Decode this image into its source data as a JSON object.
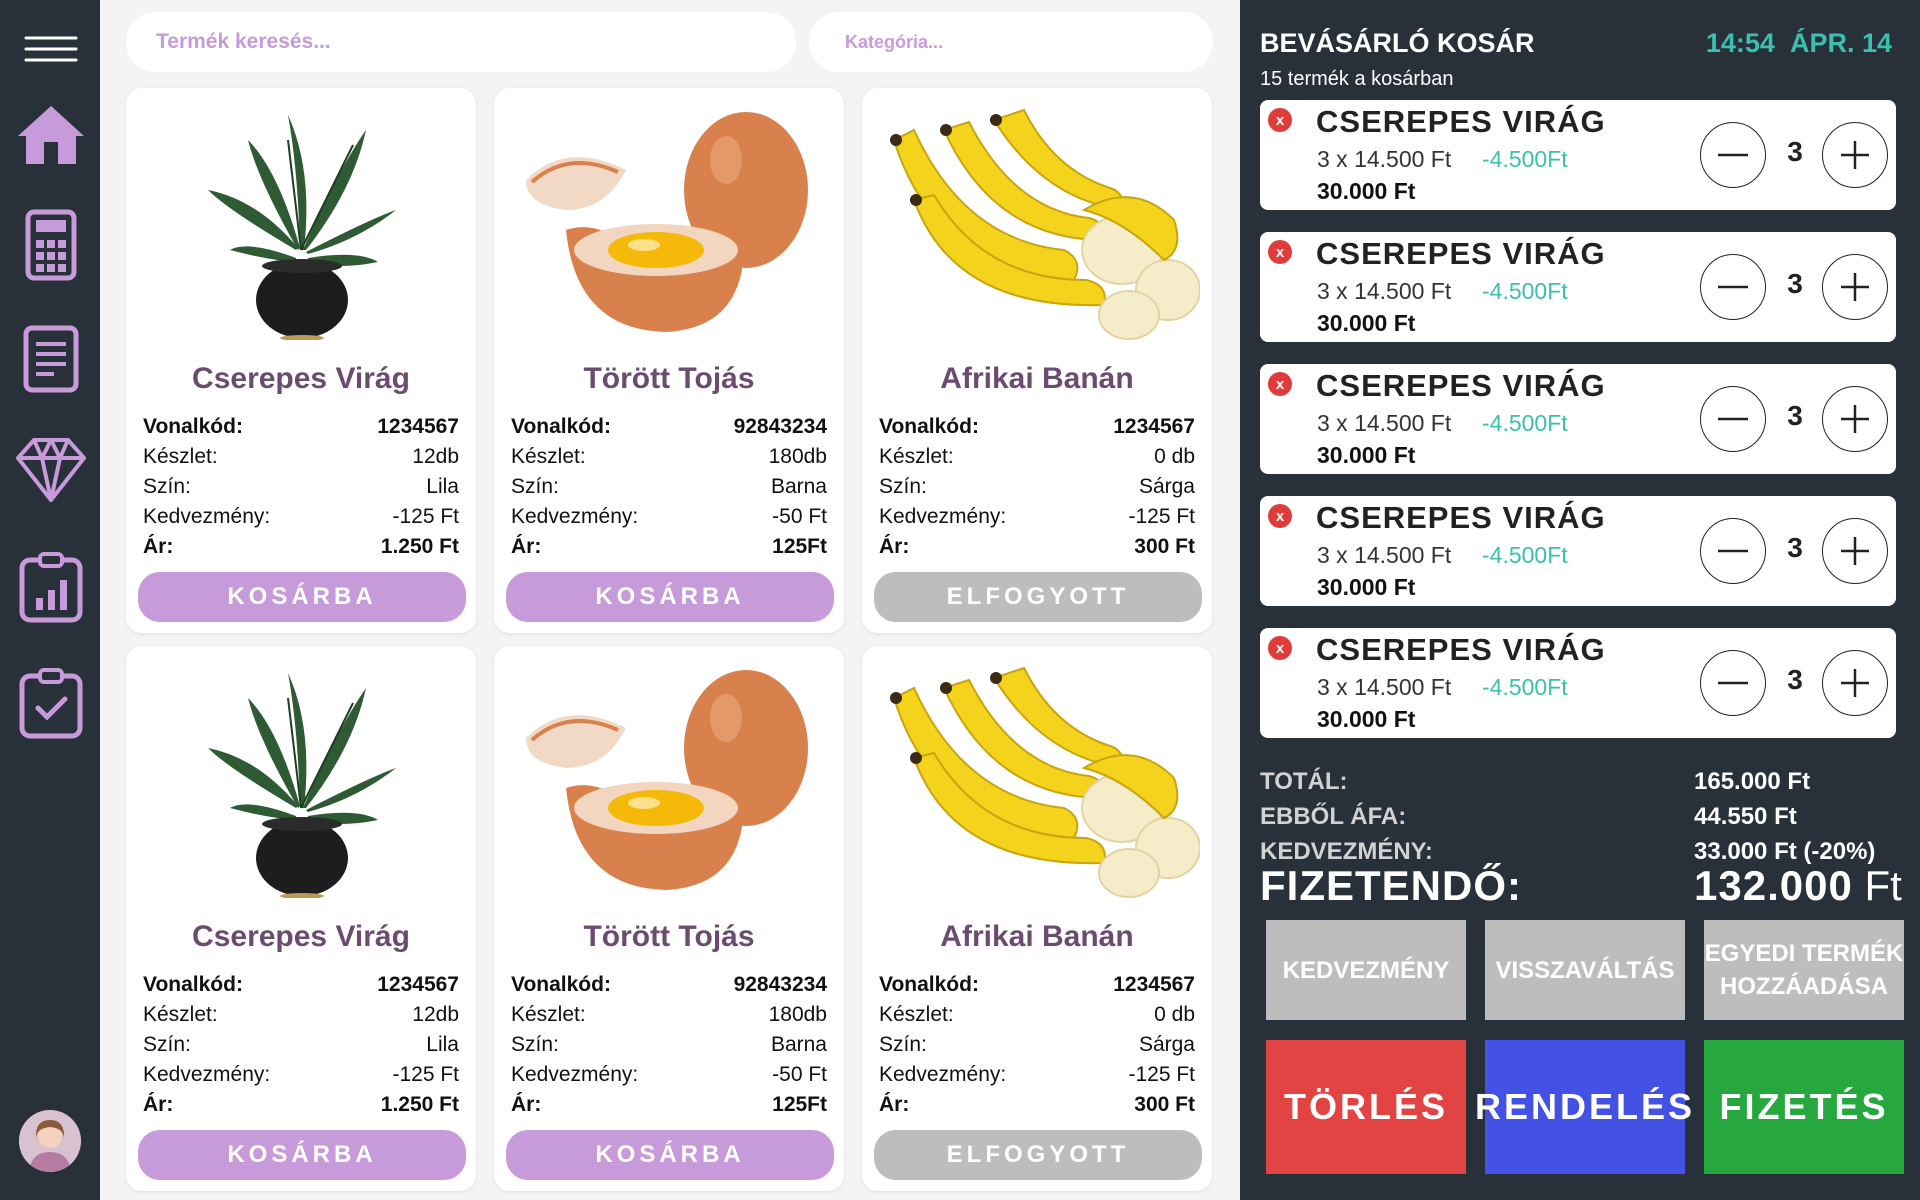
{
  "sidebar": {
    "icons": [
      "menu-icon",
      "home-icon",
      "calculator-icon",
      "document-icon",
      "diamond-icon",
      "report-icon",
      "clipboard-check-icon"
    ],
    "accent": "#c79ad9"
  },
  "search": {
    "placeholder": "Termék keresés..."
  },
  "category": {
    "placeholder": "Kategória..."
  },
  "labels": {
    "barcode": "Vonalkód:",
    "stock": "Készlet:",
    "color": "Szín:",
    "discount": "Kedvezmény:",
    "price": "Ár:"
  },
  "products": [
    {
      "title": "Cserepes Virág",
      "barcode": "1234567",
      "stock": "12db",
      "color": "Lila",
      "discount": "-125 Ft",
      "price": "1.250 Ft",
      "button": "KOSÁRBA",
      "image": "plant"
    },
    {
      "title": "Törött Tojás",
      "barcode": "92843234",
      "stock": "180db",
      "color": "Barna",
      "discount": "-50 Ft",
      "price": "125Ft",
      "button": "KOSÁRBA",
      "image": "egg"
    },
    {
      "title": "Afrikai Banán",
      "barcode": "1234567",
      "stock": "0 db",
      "color": "Sárga",
      "discount": "-125 Ft",
      "price": "300 Ft",
      "button": "ELFOGYOTT",
      "image": "banana"
    },
    {
      "title": "Cserepes Virág",
      "barcode": "1234567",
      "stock": "12db",
      "color": "Lila",
      "discount": "-125 Ft",
      "price": "1.250 Ft",
      "button": "KOSÁRBA",
      "image": "plant"
    },
    {
      "title": "Törött Tojás",
      "barcode": "92843234",
      "stock": "180db",
      "color": "Barna",
      "discount": "-50 Ft",
      "price": "125Ft",
      "button": "KOSÁRBA",
      "image": "egg"
    },
    {
      "title": "Afrikai Banán",
      "barcode": "1234567",
      "stock": "0 db",
      "color": "Sárga",
      "discount": "-125 Ft",
      "price": "300 Ft",
      "button": "ELFOGYOTT",
      "image": "banana"
    }
  ],
  "cart": {
    "title": "BEVÁSÁRLÓ KOSÁR",
    "time": "14:54",
    "date": "ÁPR. 14",
    "count": "15 termék a kosárban",
    "items": [
      {
        "name": "CSEREPES VIRÁG",
        "unit": "3 x 14.500 Ft",
        "discount": "-4.500Ft",
        "total": "30.000 Ft",
        "qty": "3"
      },
      {
        "name": "CSEREPES VIRÁG",
        "unit": "3 x 14.500 Ft",
        "discount": "-4.500Ft",
        "total": "30.000 Ft",
        "qty": "3"
      },
      {
        "name": "CSEREPES VIRÁG",
        "unit": "3 x 14.500 Ft",
        "discount": "-4.500Ft",
        "total": "30.000 Ft",
        "qty": "3"
      },
      {
        "name": "CSEREPES VIRÁG",
        "unit": "3 x 14.500 Ft",
        "discount": "-4.500Ft",
        "total": "30.000 Ft",
        "qty": "3"
      },
      {
        "name": "CSEREPES VIRÁG",
        "unit": "3 x 14.500 Ft",
        "discount": "-4.500Ft",
        "total": "30.000 Ft",
        "qty": "3"
      }
    ],
    "remove_glyph": "x",
    "totals": {
      "total_label": "TOTÁL:",
      "total_value": "165.000 Ft",
      "vat_label": "EBBŐL ÁFA:",
      "vat_value": "44.550 Ft",
      "discount_label": "KEDVEZMÉNY:",
      "discount_value": "33.000 Ft (-20%)",
      "pay_label": "FIZETENDŐ:",
      "pay_value": "132.000",
      "pay_currency": "Ft"
    },
    "actions": {
      "discount": "KEDVEZMÉNY",
      "refund": "VISSZAVÁLTÁS",
      "custom_line1": "EGYEDI TERMÉK",
      "custom_line2": "HOZZÁADÁSA",
      "delete": "TÖRLÉS",
      "order": "RENDELÉS",
      "pay": "FIZETÉS"
    },
    "colors": {
      "delete": "#e24444",
      "order": "#4352e4",
      "pay": "#27a83f",
      "teal": "#3bbfae"
    }
  }
}
